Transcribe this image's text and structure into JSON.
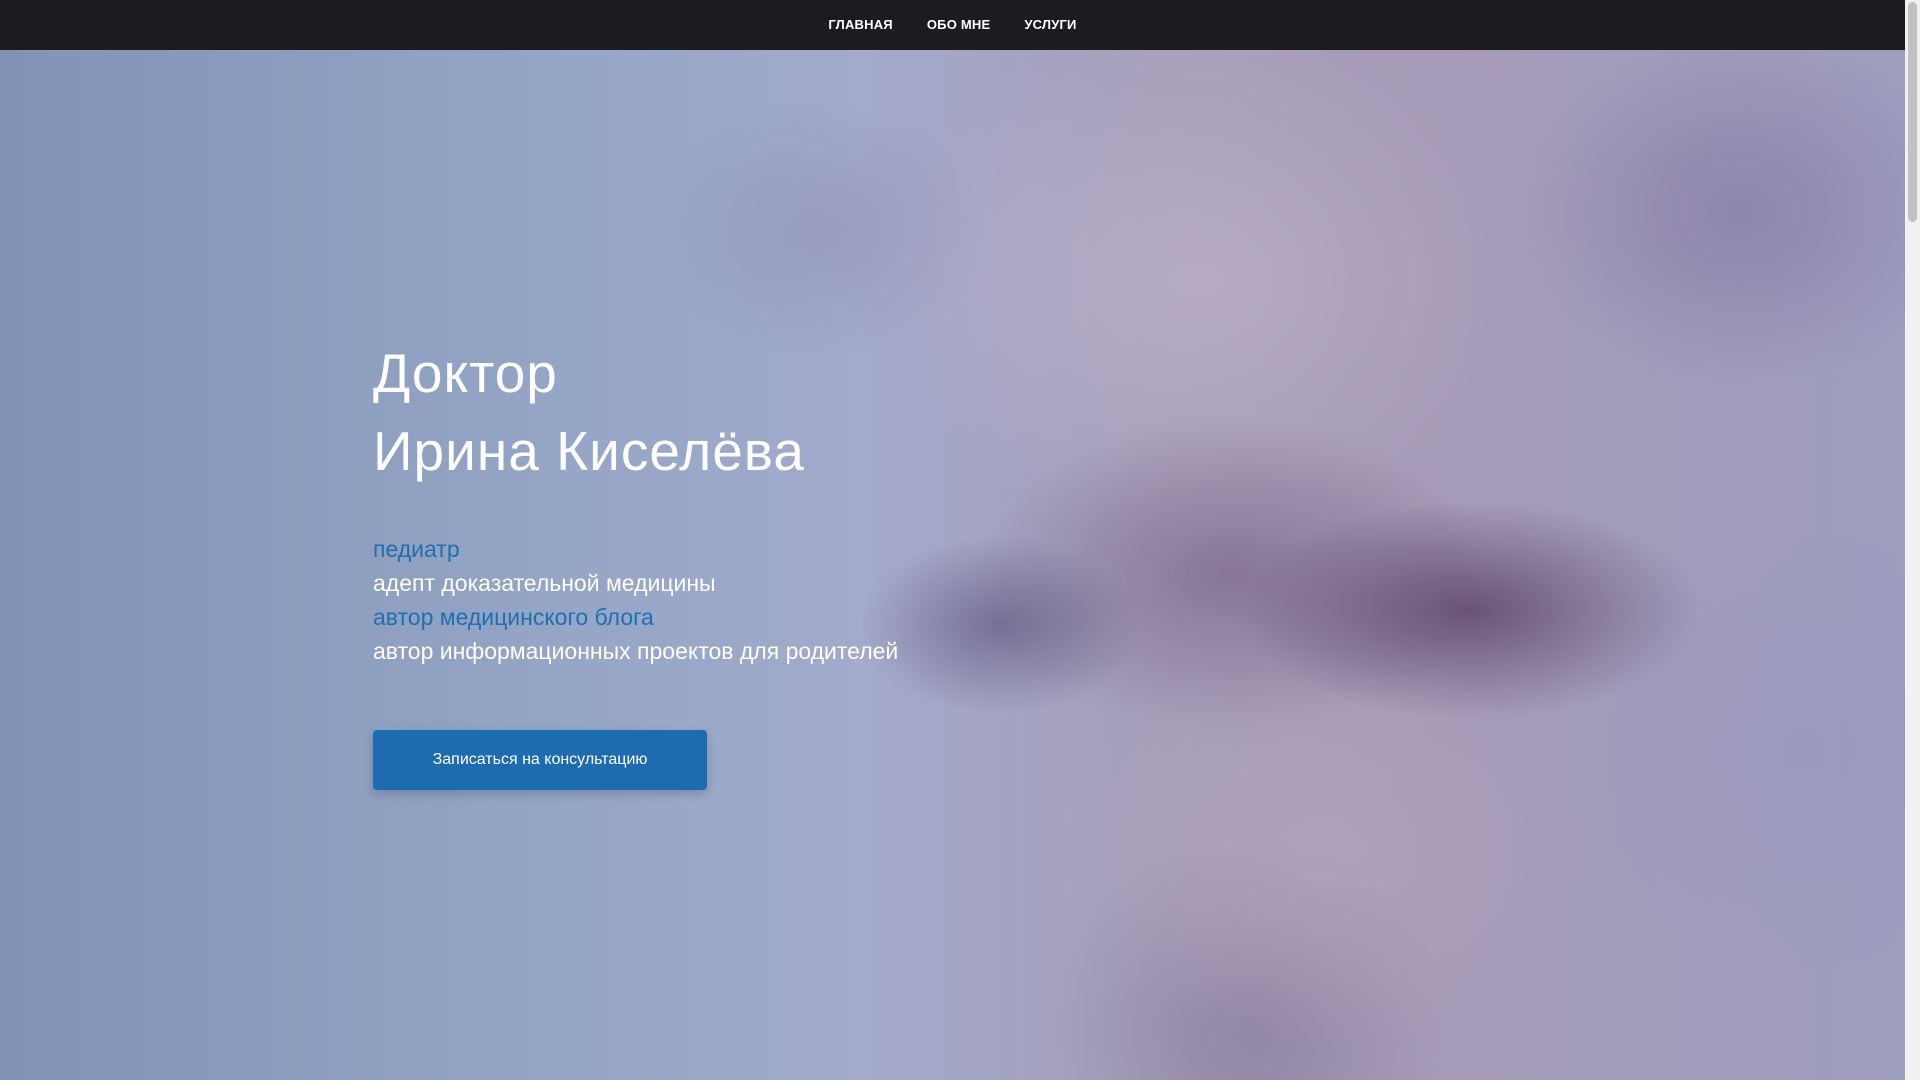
{
  "nav": {
    "items": [
      {
        "label": "ГЛАВНАЯ"
      },
      {
        "label": "ОБО МНЕ"
      },
      {
        "label": "УСЛУГИ"
      }
    ]
  },
  "hero": {
    "title_line1": "Доктор",
    "title_line2": "Ирина Киселёва",
    "roles": [
      {
        "text": "педиатр",
        "color": "blue"
      },
      {
        "text": "адепт доказательной медицины",
        "color": "white"
      },
      {
        "text": "автор медицинского блога",
        "color": "blue"
      },
      {
        "text": "автор информационных проектов для родителей",
        "color": "white"
      }
    ],
    "cta_label": "Записаться на консультацию"
  },
  "colors": {
    "navbar_bg": "#1b1c20",
    "accent_blue": "#1d6bb0",
    "text_white": "#ffffff"
  }
}
